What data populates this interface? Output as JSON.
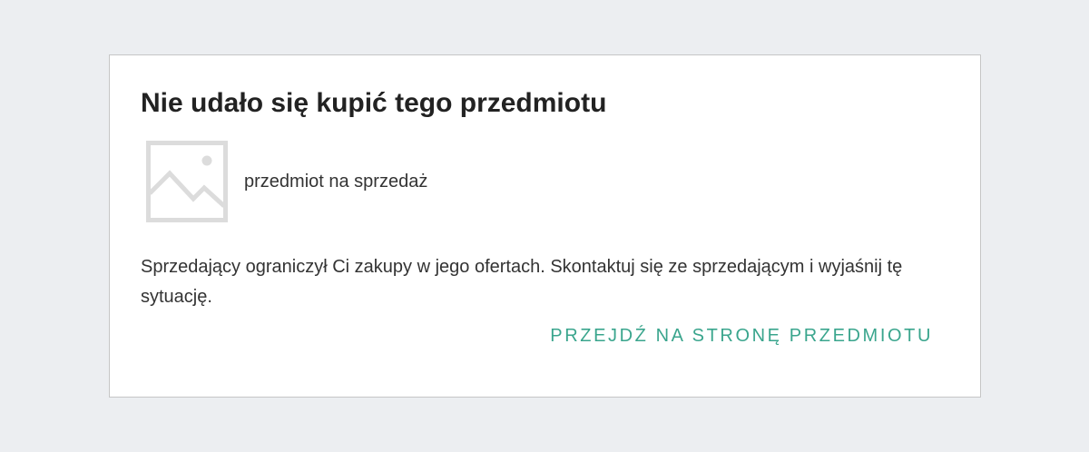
{
  "colors": {
    "page_background": "#eceef1",
    "dialog_background": "#ffffff",
    "dialog_border": "#c6c6c6",
    "title_text": "#222222",
    "body_text": "#333333",
    "accent": "#3aa58d",
    "placeholder_icon": "#dcdcdc"
  },
  "dialog": {
    "title": "Nie udało się kupić tego przedmiotu",
    "item": {
      "thumbnail_icon": "image-placeholder-icon",
      "name": "przedmiot na sprzedaż"
    },
    "message": "Sprzedający ograniczył Ci zakupy w jego ofertach. Skontaktuj się ze sprzedającym i wyjaśnij tę sytuację.",
    "action_label": "PRZEJDŹ NA STRONĘ PRZEDMIOTU"
  }
}
